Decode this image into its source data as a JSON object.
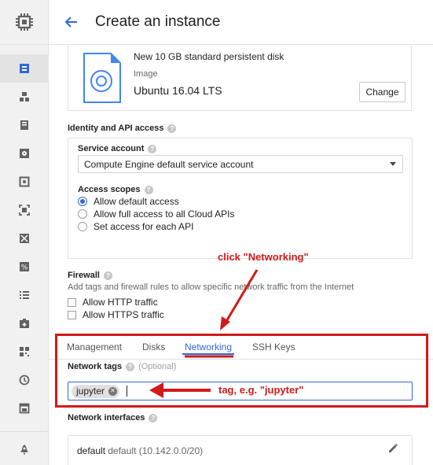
{
  "header": {
    "title": "Create an instance"
  },
  "disk": {
    "name": "New 10 GB standard persistent disk",
    "image_label": "Image",
    "os": "Ubuntu 16.04 LTS",
    "change_label": "Change"
  },
  "identity": {
    "label": "Identity and API access",
    "service_account_label": "Service account",
    "service_account_value": "Compute Engine default service account",
    "access_scopes_label": "Access scopes",
    "scopes": [
      {
        "label": "Allow default access",
        "checked": true
      },
      {
        "label": "Allow full access to all Cloud APIs",
        "checked": false
      },
      {
        "label": "Set access for each API",
        "checked": false
      }
    ]
  },
  "firewall": {
    "label": "Firewall",
    "description": "Add tags and firewall rules to allow specific network traffic from the Internet",
    "options": [
      {
        "label": "Allow HTTP traffic",
        "checked": false
      },
      {
        "label": "Allow HTTPS traffic",
        "checked": false
      }
    ]
  },
  "tabs": [
    {
      "label": "Management",
      "active": false
    },
    {
      "label": "Disks",
      "active": false
    },
    {
      "label": "Networking",
      "active": true
    },
    {
      "label": "SSH Keys",
      "active": false
    }
  ],
  "network_tags": {
    "label": "Network tags",
    "optional": "(Optional)",
    "chips": [
      "jupyter"
    ]
  },
  "network_interfaces": {
    "label": "Network interfaces",
    "name": "default",
    "detail": "default (10.142.0.0/20)"
  },
  "annotations": {
    "click_networking": "click \"Networking\"",
    "tag_example": "tag, e.g. \"jupyter\""
  },
  "colors": {
    "accent": "#3367d6",
    "annotation": "#d11a1a",
    "sidebar_bg": "#f1f1f1"
  },
  "icons": {
    "sidebar_top": "chip-icon",
    "back": "arrow-back-icon",
    "sidebar": [
      "instances-icon",
      "instance-groups-icon",
      "templates-icon",
      "disks-icon",
      "snapshots-icon",
      "images-icon",
      "tpu-icon",
      "commitments-icon",
      "metadata-icon",
      "health-checks-icon",
      "zones-icon",
      "operations-icon",
      "quotas-icon",
      "settings-icon"
    ]
  }
}
